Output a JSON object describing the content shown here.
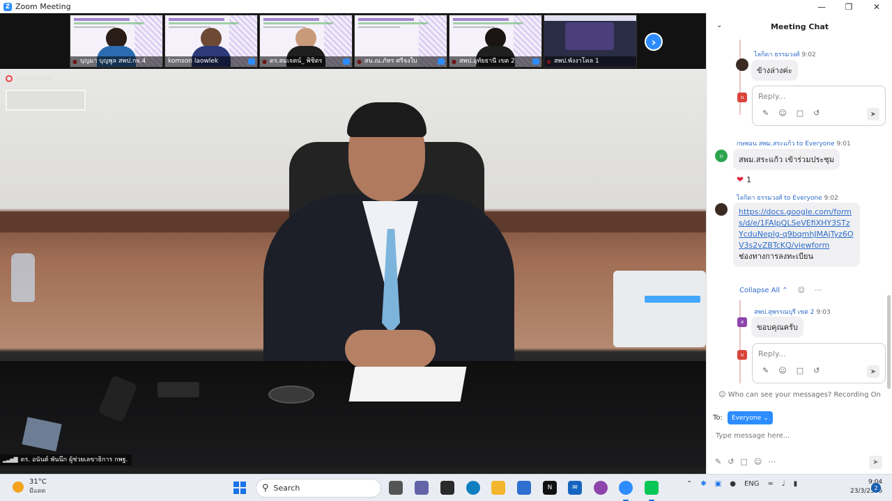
{
  "window": {
    "title": "Zoom Meeting",
    "app_icon": "Z",
    "controls": [
      "minimize",
      "maximize",
      "close"
    ]
  },
  "gallery": {
    "participants": [
      {
        "name": "บุญมา บุญพูล สพป.กจ.4",
        "muted": true,
        "shirt": "#2b6cb0"
      },
      {
        "name": "komson laowlek",
        "muted": false,
        "shirt": "#2c3a7a"
      },
      {
        "name": "ดร.สมเจตน์_ พิชิตร",
        "muted": true,
        "shirt": "#1f1f1f"
      },
      {
        "name": "สน.ณ.ภัทร ศรีจงใบ",
        "muted": true,
        "shirt": ""
      },
      {
        "name": "สพป.อุทัยธานี เขต 2",
        "muted": true,
        "shirt": "#1f1f1f"
      },
      {
        "name": "สพป.พังงาโคล 1",
        "muted": true,
        "shirt": "#2c3a7a"
      }
    ],
    "next_icon": "chevron-right-icon"
  },
  "main_video": {
    "recording_label": "Recording",
    "speaker_name": "ดร. อนันต์ พันนึก ผู้ช่วยเลขาธิการ กพฐ."
  },
  "chat": {
    "title": "Meeting Chat",
    "messages": [
      {
        "sender": "ไลกิดา ธรรมวงศ์",
        "time": "9:02",
        "text": "ข้างล่างค่ะ",
        "reply_placeholder": "Reply..."
      },
      {
        "sender": "กษพอน สพม.สระแก้ว",
        "to": "to Everyone",
        "time": "9:01",
        "text": "สพม.สระแก้ว เข้าร่วมประชุม",
        "avatar_letter": "ก",
        "reaction_count": "1"
      },
      {
        "sender": "ไลกิดา ธรรมวงศ์",
        "to": "to Everyone",
        "time": "9:02",
        "link": "https://docs.google.com/forms/d/e/1FAIpQLSeVEfiXHY3STzYcduNeplg-q9bqmhJMAjTyz6OV3s2vZBTcKQ/viewform",
        "text": "ช่องทางการลงทะเบียน"
      },
      {
        "sender": "สพป.สุพรรณบุรี เขต 2",
        "time": "9:03",
        "text": "ขอบคุณครับ",
        "avatar_letter": "ส",
        "reply_placeholder": "Reply..."
      }
    ],
    "collapse_all": "Collapse All",
    "privacy_text": "Who can see your messages? Recording On",
    "to_label": "To:",
    "to_value": "Everyone",
    "input_placeholder": "Type message here...",
    "mini_avatar_letter": "บ"
  },
  "taskbar": {
    "weather_temp": "31°C",
    "weather_desc": "มีแดด",
    "search_placeholder": "Search",
    "language": "ENG",
    "time": "9:04",
    "date": "23/3/2566",
    "notification_count": "2",
    "apps": [
      {
        "name": "file-explorer-icon",
        "color": "#444"
      },
      {
        "name": "teams-chat-icon",
        "color": "#6264a7"
      },
      {
        "name": "photos-icon",
        "color": "#2b2b2b"
      },
      {
        "name": "edge-icon",
        "color": "#0f7fc0"
      },
      {
        "name": "folder-icon",
        "color": "#f3b52b"
      },
      {
        "name": "store-icon",
        "color": "#2f6fd1"
      },
      {
        "name": "notion-icon",
        "color": "#111111"
      },
      {
        "name": "mail-icon",
        "color": "#1565c0"
      },
      {
        "name": "browser-icon",
        "color": "#8e44ad"
      },
      {
        "name": "zoom-icon",
        "color": "#2d8cff"
      },
      {
        "name": "line-icon",
        "color": "#06c755"
      }
    ]
  }
}
